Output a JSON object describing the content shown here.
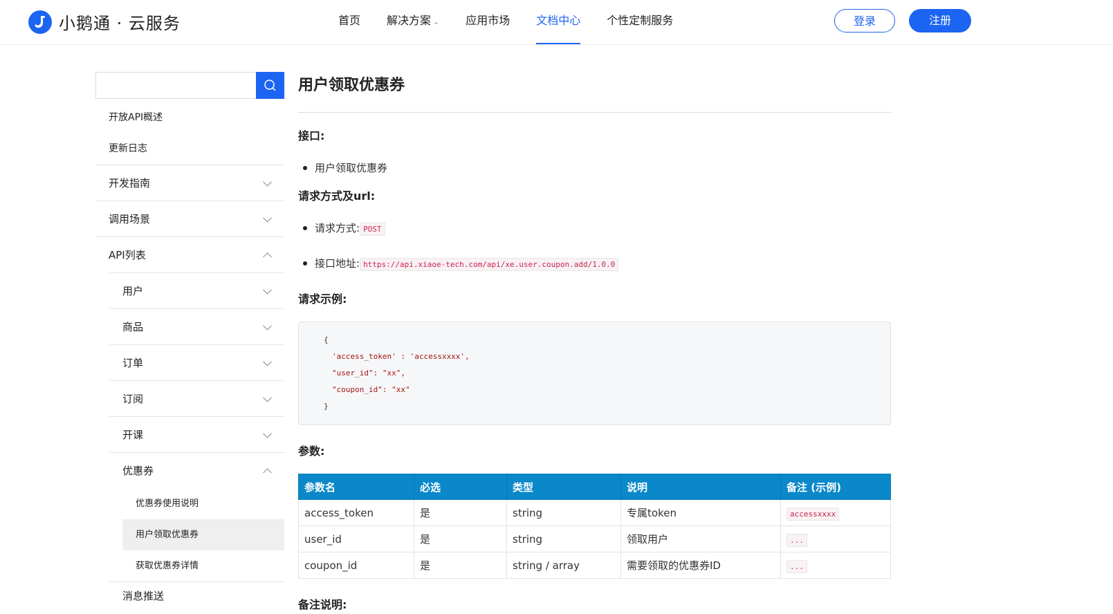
{
  "header": {
    "brand": "小鹅通 · 云服务",
    "nav": [
      {
        "label": "首页"
      },
      {
        "label": "解决方案"
      },
      {
        "label": "应用市场"
      },
      {
        "label": "文档中心"
      },
      {
        "label": "个性定制服务"
      }
    ],
    "active_nav": "文档中心",
    "login_label": "登录",
    "register_label": "注册"
  },
  "colors": {
    "accent": "#1c64f2",
    "table_header": "#0a88c9",
    "code_text": "#c7254e"
  },
  "sidebar": {
    "search_value": "",
    "plain": [
      "开放API概述",
      "更新日志"
    ],
    "groups": [
      "开发指南",
      "调用场景",
      "API列表"
    ],
    "api_subgroups": [
      "用户",
      "商品",
      "订单",
      "订阅",
      "开课",
      "优惠券"
    ],
    "coupon_items": [
      "优惠券使用说明",
      "用户领取优惠券",
      "获取优惠券详情"
    ],
    "cut_off_item": "消息推送"
  },
  "doc": {
    "title": "用户领取优惠券",
    "interface_heading": "接口:",
    "interface_name": "用户领取优惠券",
    "method_heading": "请求方式及url:",
    "method_label": "请求方式:",
    "method_value": "POST",
    "url_label": "接口地址:",
    "url_value": "https://api.xiaoe-tech.com/api/xe.user.coupon.add/1.0.0",
    "example_heading": "请求示例:",
    "example_lines": [
      "{",
      "'access_token' : 'accessxxxx',",
      "\"user_id\": \"xx\",",
      "\"coupon_id\": \"xx\"",
      "}"
    ],
    "params_heading": "参数:",
    "params_columns": [
      "参数名",
      "必选",
      "类型",
      "说明",
      "备注 (示例)"
    ],
    "params_rows": [
      {
        "name": "access_token",
        "required": "是",
        "type": "string",
        "desc": "专属token",
        "note": "accessxxxx"
      },
      {
        "name": "user_id",
        "required": "是",
        "type": "string",
        "desc": "领取用户",
        "note": "..."
      },
      {
        "name": "coupon_id",
        "required": "是",
        "type": "string / array",
        "desc": "需要领取的优惠券ID",
        "note": "..."
      }
    ],
    "remarks_heading": "备注说明:"
  }
}
